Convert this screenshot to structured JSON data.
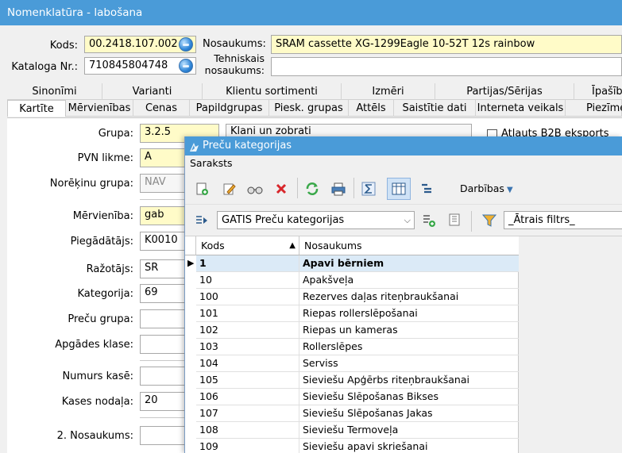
{
  "window": {
    "title": "Nomenklatūra - labošana"
  },
  "header": {
    "kods_label": "Kods:",
    "kods_value": "00.2418.107.002",
    "kataloga_label": "Kataloga Nr.:",
    "kataloga_value": "710845804748",
    "nosaukums_label": "Nosaukums:",
    "nosaukums_value": "SRAM cassette XG-1299Eagle 10-52T 12s rainbow",
    "tehniskais_label1": "Tehniskais",
    "tehniskais_label2": "nosaukums:",
    "tehniskais_value": ""
  },
  "tabs_row1": [
    "Sinonīmi",
    "Varianti",
    "Klientu sortimenti",
    "Izmēri",
    "Partijas/Sērijas",
    "Īpašīb"
  ],
  "tabs_row2": [
    "Kartīte",
    "Mērvienības",
    "Cenas",
    "Papildgrupas",
    "Piesk. grupas",
    "Attēls",
    "Saistītie dati",
    "Interneta veikals",
    "Piezīme"
  ],
  "form": {
    "grupa_label": "Grupa:",
    "grupa_value": "3.2.5",
    "grupa_desc": "Klani un zobrati",
    "b2b_label": "Atļauts B2B eksports",
    "pvn_label": "PVN likme:",
    "pvn_value": "A",
    "norekinu_label": "Norēķinu grupa:",
    "norekinu_value": "NAV",
    "mervieniba_label": "Mērvienība:",
    "mervieniba_value": "gab",
    "piegadatajs_label": "Piegādātājs:",
    "piegadatajs_value": "K0010",
    "razotajs_label": "Ražotājs:",
    "razotajs_value": "SR",
    "kategorija_label": "Kategorija:",
    "kategorija_value": "69",
    "precu_grupa_label": "Preču grupa:",
    "precu_grupa_value": "",
    "apgades_label": "Apgādes klase:",
    "apgades_value": "",
    "numurs_label": "Numurs kasē:",
    "numurs_value": "",
    "kases_label": "Kases nodaļa:",
    "kases_value": "20",
    "nos2_label": "2. Nosaukums:",
    "nos2_value": ""
  },
  "popup": {
    "title": "Preču kategorijas",
    "menu": "Saraksts",
    "actions_label": "Darbības",
    "view_select": "GATIS Preču kategorijas",
    "filter_placeholder": "_Ātrais filtrs_",
    "col_kods": "Kods",
    "col_nosaukums": "Nosaukums",
    "rows": [
      {
        "kods": "1",
        "nosaukums": "Apavi bērniem"
      },
      {
        "kods": "10",
        "nosaukums": "Apakšveļa"
      },
      {
        "kods": "100",
        "nosaukums": "Rezerves daļas riteņbraukšanai"
      },
      {
        "kods": "101",
        "nosaukums": "Riepas rollerslēpošanai"
      },
      {
        "kods": "102",
        "nosaukums": "Riepas un kameras"
      },
      {
        "kods": "103",
        "nosaukums": "Rollerslēpes"
      },
      {
        "kods": "104",
        "nosaukums": "Serviss"
      },
      {
        "kods": "105",
        "nosaukums": "Sieviešu Apģērbs riteņbraukšanai"
      },
      {
        "kods": "106",
        "nosaukums": "Sieviešu Slēpošanas Bikses"
      },
      {
        "kods": "107",
        "nosaukums": "Sieviešu Slēpošanas Jakas"
      },
      {
        "kods": "108",
        "nosaukums": "Sieviešu Termoveļa"
      },
      {
        "kods": "109",
        "nosaukums": "Sieviešu apavi skriešanai"
      }
    ]
  },
  "colors": {
    "titlebar": "#4a9bd8",
    "yellow_field": "#fffbc8",
    "selected_row": "#dbeaf7"
  }
}
